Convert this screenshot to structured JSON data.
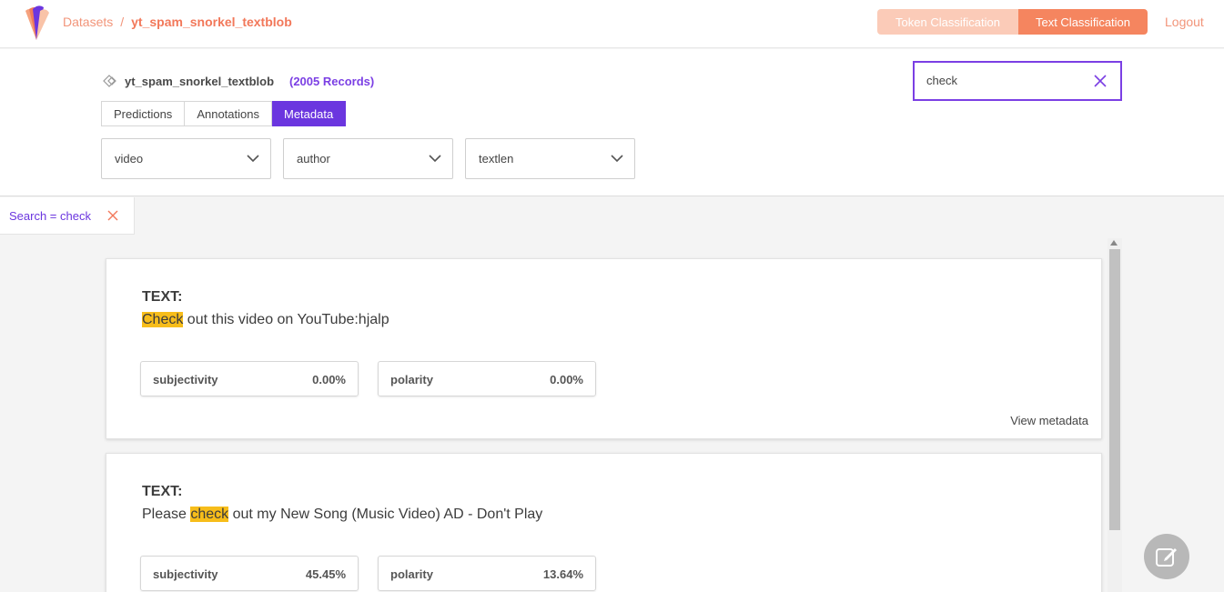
{
  "topbar": {
    "breadcrumb_root": "Datasets",
    "breadcrumb_sep": "/",
    "breadcrumb_current": "yt_spam_snorkel_textblob",
    "tab_token": "Token Classification",
    "tab_text": "Text Classification",
    "logout": "Logout"
  },
  "dataset": {
    "name": "yt_spam_snorkel_textblob",
    "records": "(2005 Records)"
  },
  "view_tabs": [
    {
      "label": "Predictions",
      "active": false
    },
    {
      "label": "Annotations",
      "active": false
    },
    {
      "label": "Metadata",
      "active": true
    }
  ],
  "filters": [
    {
      "label": "video"
    },
    {
      "label": "author"
    },
    {
      "label": "textlen"
    }
  ],
  "search": {
    "value": "check"
  },
  "active_filter": {
    "label": "Search = check"
  },
  "records": [
    {
      "field_label": "TEXT:",
      "text_before": "",
      "highlight": "Check",
      "text_after": " out this video on YouTube:hjalp",
      "metrics": [
        {
          "name": "subjectivity",
          "value": "0.00%"
        },
        {
          "name": "polarity",
          "value": "0.00%"
        }
      ],
      "view_metadata": "View metadata"
    },
    {
      "field_label": "TEXT:",
      "text_before": "Please ",
      "highlight": "check",
      "text_after": " out my New Song (Music Video) AD - Don't Play",
      "metrics": [
        {
          "name": "subjectivity",
          "value": "45.45%"
        },
        {
          "name": "polarity",
          "value": "13.64%"
        }
      ]
    }
  ],
  "colors": {
    "accent_purple": "#6b36df",
    "accent_orange": "#f5855f",
    "highlight": "#f7bd1a"
  },
  "icons": {
    "logo": "app-logo",
    "dataset": "dataset-diamond-icon",
    "dropdown": "chevron-down-icon",
    "clear": "close-icon",
    "fab": "edit-icon"
  }
}
